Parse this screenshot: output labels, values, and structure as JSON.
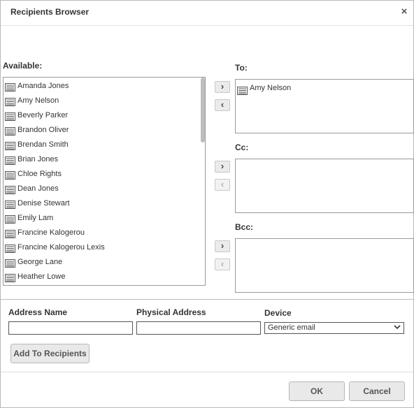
{
  "window": {
    "title": "Recipients Browser",
    "close_glyph": "×",
    "close_icon": "close-icon"
  },
  "available": {
    "label": "Available:",
    "items": [
      "Amanda Jones",
      "Amy Nelson",
      "Beverly Parker",
      "Brandon Oliver",
      "Brendan Smith",
      "Brian Jones",
      "Chloe Rights",
      "Dean Jones",
      "Denise Stewart",
      "Emily Lam",
      "Francine Kalogerou",
      "Francine Kalogerou Lexis",
      "George Lane",
      "Heather Lowe"
    ],
    "item_icon": "address-card-icon"
  },
  "arrows": {
    "add_glyph": "›",
    "remove_glyph": "‹"
  },
  "to": {
    "label": "To:",
    "items": [
      "Amy Nelson"
    ]
  },
  "cc": {
    "label": "Cc:",
    "items": []
  },
  "bcc": {
    "label": "Bcc:",
    "items": []
  },
  "form": {
    "address_name_label": "Address Name",
    "address_name_value": "",
    "physical_address_label": "Physical Address",
    "physical_address_value": "",
    "device_label": "Device",
    "device_value": "Generic email",
    "device_chevron": "⌄",
    "add_button": "Add To Recipients"
  },
  "footer": {
    "ok": "OK",
    "cancel": "Cancel"
  }
}
